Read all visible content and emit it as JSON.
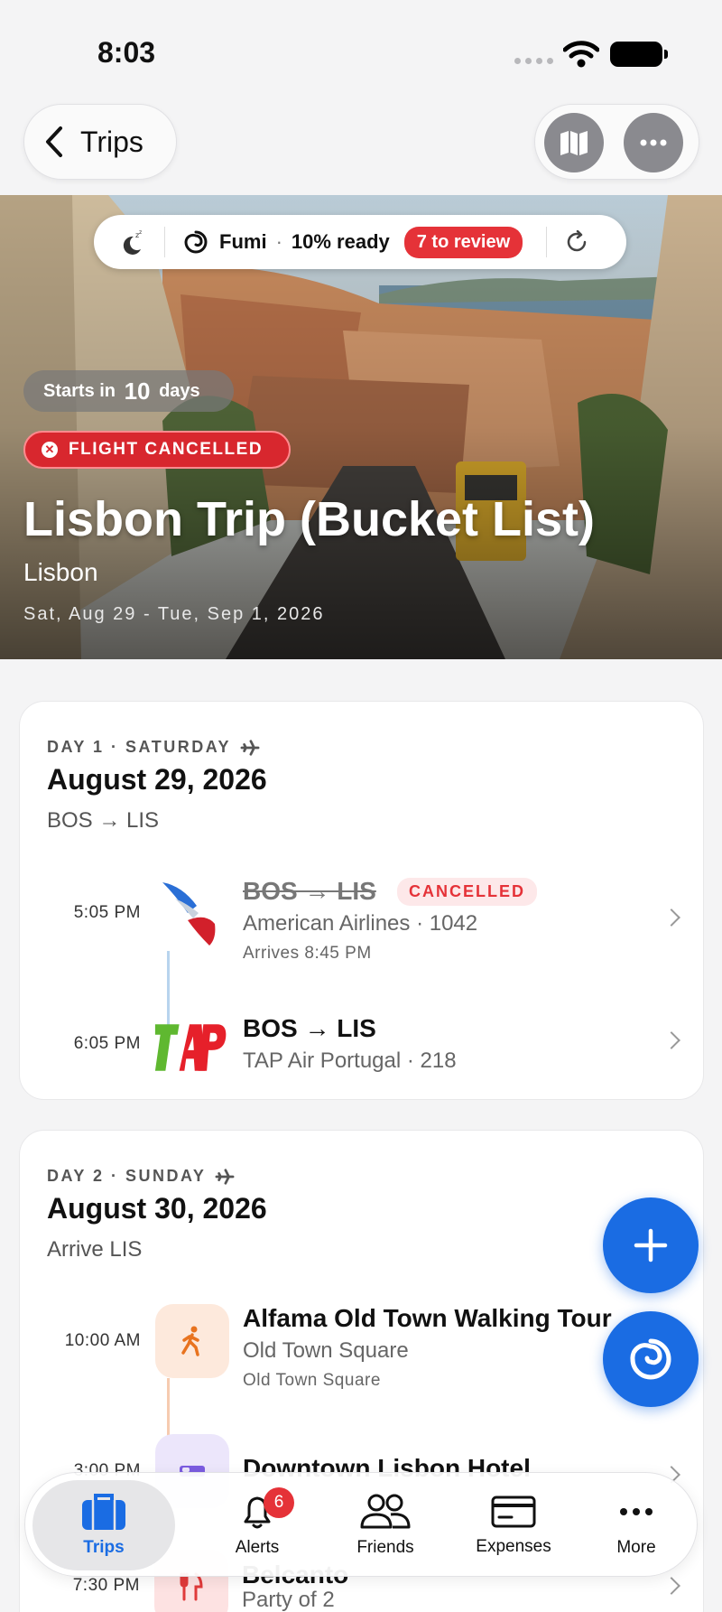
{
  "status_bar": {
    "time": "8:03"
  },
  "nav": {
    "back_label": "Trips"
  },
  "fumi": {
    "name": "Fumi",
    "ready": "10% ready",
    "review": "7 to review"
  },
  "hero": {
    "starts_prefix": "Starts in",
    "starts_days": "10",
    "starts_suffix": "days",
    "status": "FLIGHT CANCELLED",
    "title": "Lisbon Trip (Bucket List)",
    "city": "Lisbon",
    "dates": "Sat, Aug 29 - Tue, Sep 1, 2026"
  },
  "days": [
    {
      "label": "DAY 1 · SATURDAY",
      "date": "August 29, 2026",
      "route": "BOS → LIS",
      "items": [
        {
          "time": "5:05 PM",
          "title": "BOS → LIS",
          "status": "CANCELLED",
          "sub": "American Airlines · 1042",
          "meta": "Arrives 8:45 PM"
        },
        {
          "time": "6:05 PM",
          "title": "BOS → LIS",
          "sub": "TAP Air Portugal · 218"
        }
      ]
    },
    {
      "label": "DAY 2 · SUNDAY",
      "date": "August 30, 2026",
      "route": "Arrive LIS",
      "items": [
        {
          "time": "10:00 AM",
          "title": "Alfama Old Town Walking Tour",
          "sub": "Old Town Square",
          "meta": "Old Town Square"
        },
        {
          "time": "3:00 PM",
          "title": "Downtown Lisbon Hotel"
        },
        {
          "time": "7:30 PM",
          "title": "Belcanto",
          "sub": "Party of 2"
        }
      ]
    }
  ],
  "tabs": [
    {
      "label": "Trips"
    },
    {
      "label": "Alerts",
      "badge": "6"
    },
    {
      "label": "Friends"
    },
    {
      "label": "Expenses"
    },
    {
      "label": "More"
    }
  ],
  "colors": {
    "accent": "#1a6ce3",
    "danger": "#e53238",
    "tap_green": "#5fb830",
    "tap_red": "#e6202a"
  }
}
